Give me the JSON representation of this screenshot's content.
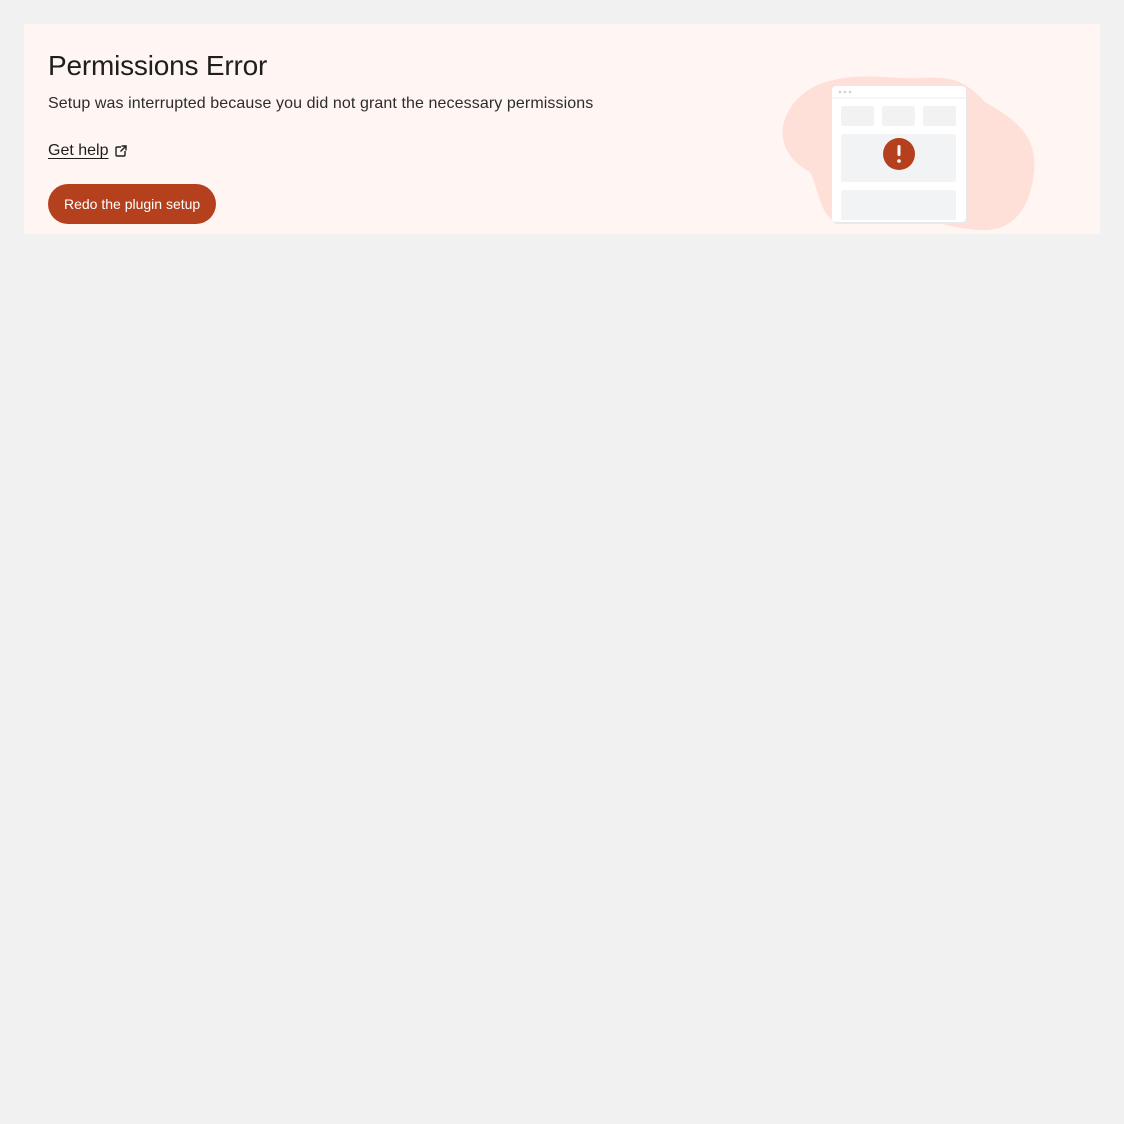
{
  "notice": {
    "title": "Permissions Error",
    "message": "Setup was interrupted because you did not grant the necessary permissions",
    "help_link_label": "Get help",
    "help_link_icon": "external-link-icon",
    "redo_button_label": "Redo the plugin setup"
  },
  "illustration": {
    "status_icon": "exclamation-icon",
    "status_glyph": "!"
  },
  "colors": {
    "page_background": "#f1f1f1",
    "banner_background": "#fff6f4",
    "accent": "#b5401e",
    "blob": "#ffe0d8"
  }
}
